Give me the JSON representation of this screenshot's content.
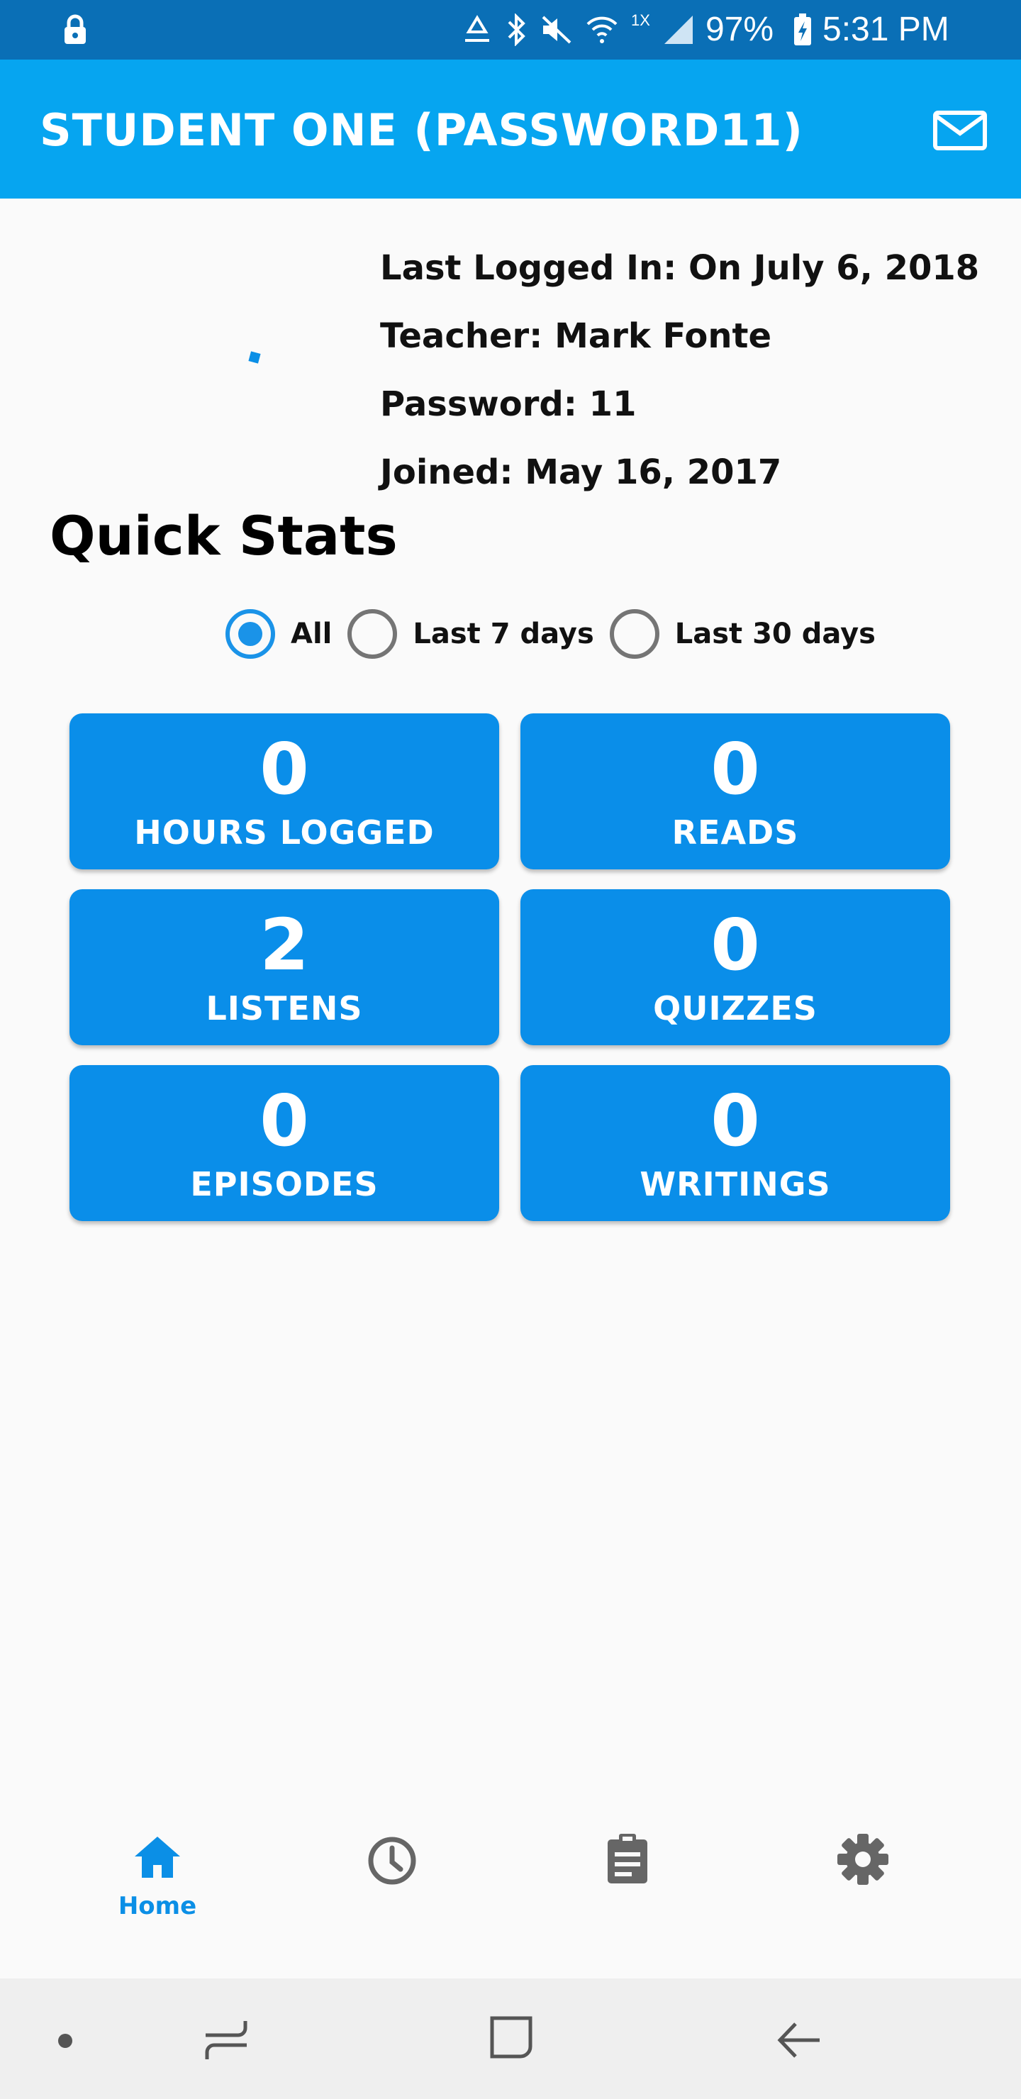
{
  "status_bar": {
    "battery": "97%",
    "time": "5:31 PM",
    "network_type": "1X",
    "icons": [
      "lock-icon",
      "recycle-icon",
      "bluetooth-icon",
      "mute-icon",
      "wifi-icon",
      "signal-icon",
      "battery-charging-icon"
    ]
  },
  "app_bar": {
    "title": "STUDENT ONE (PASSWORD11)",
    "mail_icon": "mail-icon"
  },
  "profile": {
    "last_logged_in": "Last Logged In: On July 6, 2018",
    "teacher": "Teacher: Mark Fonte",
    "password": "Password: 11",
    "joined": "Joined: May 16, 2017"
  },
  "quick_stats": {
    "title": "Quick Stats",
    "filters": [
      {
        "label": "All",
        "checked": true
      },
      {
        "label": "Last 7 days",
        "checked": false
      },
      {
        "label": "Last 30 days",
        "checked": false
      }
    ],
    "cards": [
      {
        "value": "0",
        "label": "HOURS LOGGED"
      },
      {
        "value": "0",
        "label": "READS"
      },
      {
        "value": "2",
        "label": "LISTENS"
      },
      {
        "value": "0",
        "label": "QUIZZES"
      },
      {
        "value": "0",
        "label": "EPISODES"
      },
      {
        "value": "0",
        "label": "WRITINGS"
      }
    ]
  },
  "bottom_nav": {
    "home_label": "Home",
    "items": [
      "home-icon",
      "history-icon",
      "assignment-icon",
      "settings-icon"
    ]
  },
  "colors": {
    "status_bar": "#0a6fb6",
    "app_bar": "#06a5f0",
    "card": "#0a8ee9",
    "accent": "#1a93e8"
  }
}
